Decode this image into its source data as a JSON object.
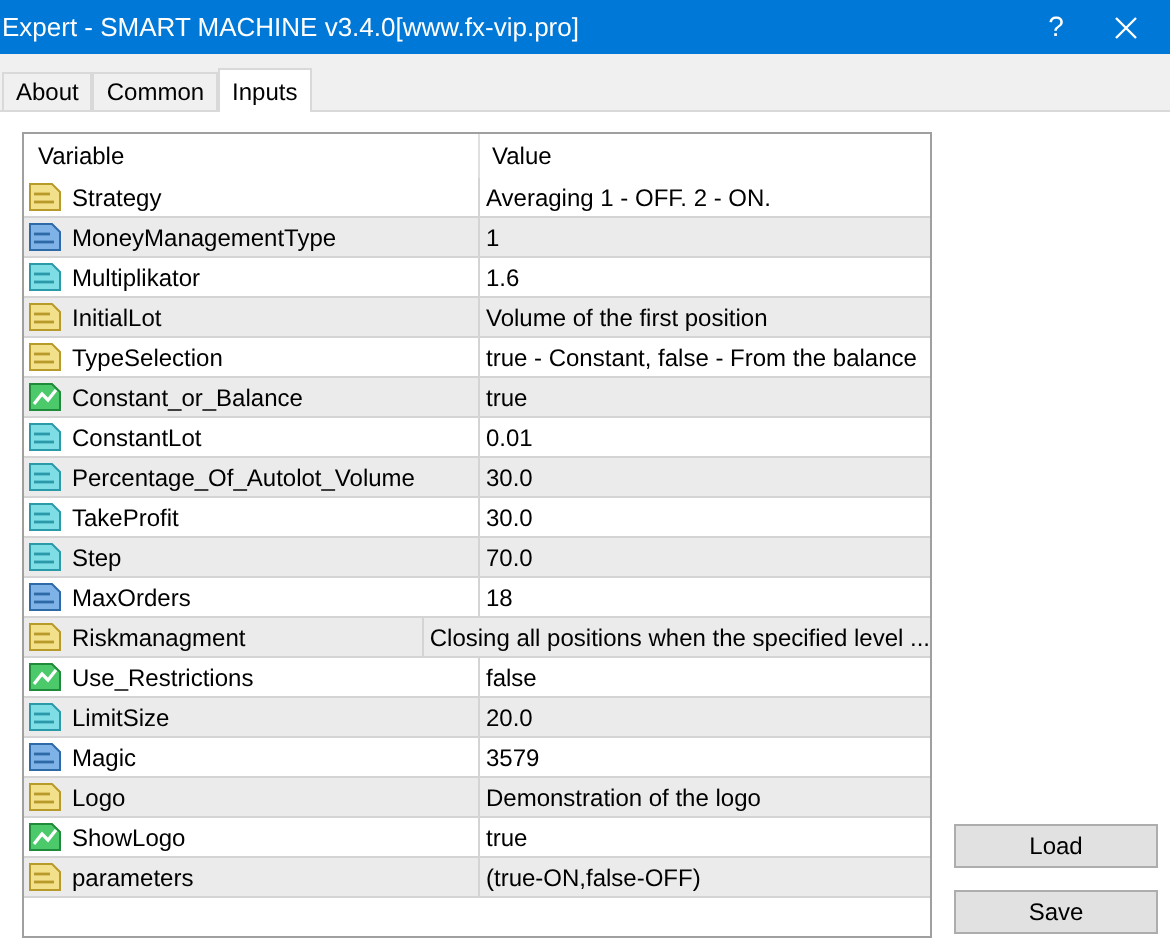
{
  "window": {
    "title": "Expert - SMART MACHINE v3.4.0[www.fx-vip.pro]",
    "help": "?"
  },
  "tabs": [
    {
      "label": "About",
      "selected": false
    },
    {
      "label": "Common",
      "selected": false
    },
    {
      "label": "Inputs",
      "selected": true
    }
  ],
  "table": {
    "columns": [
      "Variable",
      "Value"
    ],
    "rows": [
      {
        "kind": "string",
        "variable": "Strategy",
        "value": "Averaging 1 - OFF. 2 - ON."
      },
      {
        "kind": "integer",
        "variable": "MoneyManagementType",
        "value": "1"
      },
      {
        "kind": "double",
        "variable": "Multiplikator",
        "value": "1.6"
      },
      {
        "kind": "string",
        "variable": "InitialLot",
        "value": "Volume of the first position"
      },
      {
        "kind": "string",
        "variable": "TypeSelection",
        "value": "true - Constant, false - From the balance"
      },
      {
        "kind": "bool",
        "variable": "Constant_or_Balance",
        "value": "true"
      },
      {
        "kind": "double",
        "variable": "ConstantLot",
        "value": "0.01"
      },
      {
        "kind": "double",
        "variable": "Percentage_Of_Autolot_Volume",
        "value": "30.0"
      },
      {
        "kind": "double",
        "variable": "TakeProfit",
        "value": "30.0"
      },
      {
        "kind": "double",
        "variable": "Step",
        "value": "70.0"
      },
      {
        "kind": "integer",
        "variable": "MaxOrders",
        "value": "18"
      },
      {
        "kind": "string",
        "variable": "Riskmanagment",
        "value": "Closing all positions when the specified level ..."
      },
      {
        "kind": "bool",
        "variable": "Use_Restrictions",
        "value": "false"
      },
      {
        "kind": "double",
        "variable": "LimitSize",
        "value": "20.0"
      },
      {
        "kind": "integer",
        "variable": "Magic",
        "value": "3579"
      },
      {
        "kind": "string",
        "variable": "Logo",
        "value": "Demonstration of the logo"
      },
      {
        "kind": "bool",
        "variable": "ShowLogo",
        "value": "true"
      },
      {
        "kind": "string",
        "variable": "parameters",
        "value": "(true-ON,false-OFF)"
      }
    ]
  },
  "buttons": [
    "Load",
    "Save"
  ]
}
